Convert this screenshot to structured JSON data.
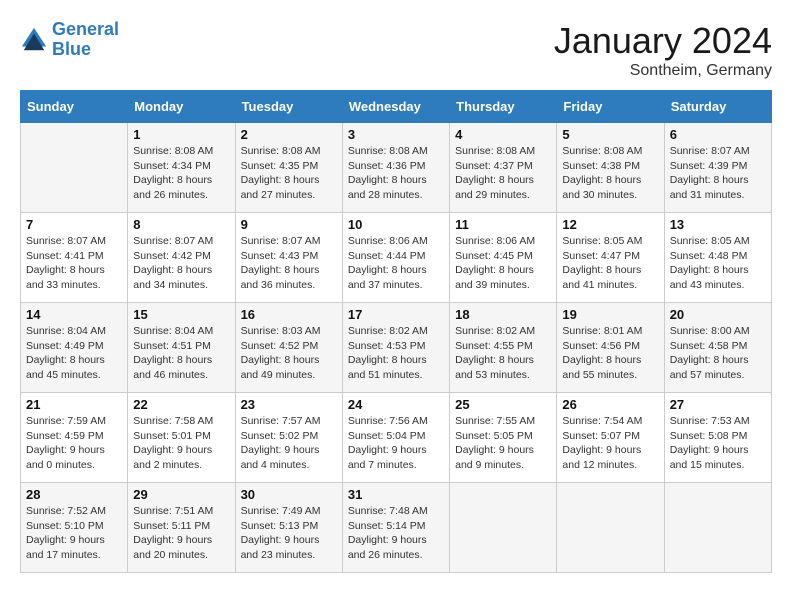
{
  "header": {
    "logo_line1": "General",
    "logo_line2": "Blue",
    "month": "January 2024",
    "location": "Sontheim, Germany"
  },
  "days_of_week": [
    "Sunday",
    "Monday",
    "Tuesday",
    "Wednesday",
    "Thursday",
    "Friday",
    "Saturday"
  ],
  "weeks": [
    [
      {
        "day": "",
        "sunrise": "",
        "sunset": "",
        "daylight": ""
      },
      {
        "day": "1",
        "sunrise": "Sunrise: 8:08 AM",
        "sunset": "Sunset: 4:34 PM",
        "daylight": "Daylight: 8 hours and 26 minutes."
      },
      {
        "day": "2",
        "sunrise": "Sunrise: 8:08 AM",
        "sunset": "Sunset: 4:35 PM",
        "daylight": "Daylight: 8 hours and 27 minutes."
      },
      {
        "day": "3",
        "sunrise": "Sunrise: 8:08 AM",
        "sunset": "Sunset: 4:36 PM",
        "daylight": "Daylight: 8 hours and 28 minutes."
      },
      {
        "day": "4",
        "sunrise": "Sunrise: 8:08 AM",
        "sunset": "Sunset: 4:37 PM",
        "daylight": "Daylight: 8 hours and 29 minutes."
      },
      {
        "day": "5",
        "sunrise": "Sunrise: 8:08 AM",
        "sunset": "Sunset: 4:38 PM",
        "daylight": "Daylight: 8 hours and 30 minutes."
      },
      {
        "day": "6",
        "sunrise": "Sunrise: 8:07 AM",
        "sunset": "Sunset: 4:39 PM",
        "daylight": "Daylight: 8 hours and 31 minutes."
      }
    ],
    [
      {
        "day": "7",
        "sunrise": "Sunrise: 8:07 AM",
        "sunset": "Sunset: 4:41 PM",
        "daylight": "Daylight: 8 hours and 33 minutes."
      },
      {
        "day": "8",
        "sunrise": "Sunrise: 8:07 AM",
        "sunset": "Sunset: 4:42 PM",
        "daylight": "Daylight: 8 hours and 34 minutes."
      },
      {
        "day": "9",
        "sunrise": "Sunrise: 8:07 AM",
        "sunset": "Sunset: 4:43 PM",
        "daylight": "Daylight: 8 hours and 36 minutes."
      },
      {
        "day": "10",
        "sunrise": "Sunrise: 8:06 AM",
        "sunset": "Sunset: 4:44 PM",
        "daylight": "Daylight: 8 hours and 37 minutes."
      },
      {
        "day": "11",
        "sunrise": "Sunrise: 8:06 AM",
        "sunset": "Sunset: 4:45 PM",
        "daylight": "Daylight: 8 hours and 39 minutes."
      },
      {
        "day": "12",
        "sunrise": "Sunrise: 8:05 AM",
        "sunset": "Sunset: 4:47 PM",
        "daylight": "Daylight: 8 hours and 41 minutes."
      },
      {
        "day": "13",
        "sunrise": "Sunrise: 8:05 AM",
        "sunset": "Sunset: 4:48 PM",
        "daylight": "Daylight: 8 hours and 43 minutes."
      }
    ],
    [
      {
        "day": "14",
        "sunrise": "Sunrise: 8:04 AM",
        "sunset": "Sunset: 4:49 PM",
        "daylight": "Daylight: 8 hours and 45 minutes."
      },
      {
        "day": "15",
        "sunrise": "Sunrise: 8:04 AM",
        "sunset": "Sunset: 4:51 PM",
        "daylight": "Daylight: 8 hours and 46 minutes."
      },
      {
        "day": "16",
        "sunrise": "Sunrise: 8:03 AM",
        "sunset": "Sunset: 4:52 PM",
        "daylight": "Daylight: 8 hours and 49 minutes."
      },
      {
        "day": "17",
        "sunrise": "Sunrise: 8:02 AM",
        "sunset": "Sunset: 4:53 PM",
        "daylight": "Daylight: 8 hours and 51 minutes."
      },
      {
        "day": "18",
        "sunrise": "Sunrise: 8:02 AM",
        "sunset": "Sunset: 4:55 PM",
        "daylight": "Daylight: 8 hours and 53 minutes."
      },
      {
        "day": "19",
        "sunrise": "Sunrise: 8:01 AM",
        "sunset": "Sunset: 4:56 PM",
        "daylight": "Daylight: 8 hours and 55 minutes."
      },
      {
        "day": "20",
        "sunrise": "Sunrise: 8:00 AM",
        "sunset": "Sunset: 4:58 PM",
        "daylight": "Daylight: 8 hours and 57 minutes."
      }
    ],
    [
      {
        "day": "21",
        "sunrise": "Sunrise: 7:59 AM",
        "sunset": "Sunset: 4:59 PM",
        "daylight": "Daylight: 9 hours and 0 minutes."
      },
      {
        "day": "22",
        "sunrise": "Sunrise: 7:58 AM",
        "sunset": "Sunset: 5:01 PM",
        "daylight": "Daylight: 9 hours and 2 minutes."
      },
      {
        "day": "23",
        "sunrise": "Sunrise: 7:57 AM",
        "sunset": "Sunset: 5:02 PM",
        "daylight": "Daylight: 9 hours and 4 minutes."
      },
      {
        "day": "24",
        "sunrise": "Sunrise: 7:56 AM",
        "sunset": "Sunset: 5:04 PM",
        "daylight": "Daylight: 9 hours and 7 minutes."
      },
      {
        "day": "25",
        "sunrise": "Sunrise: 7:55 AM",
        "sunset": "Sunset: 5:05 PM",
        "daylight": "Daylight: 9 hours and 9 minutes."
      },
      {
        "day": "26",
        "sunrise": "Sunrise: 7:54 AM",
        "sunset": "Sunset: 5:07 PM",
        "daylight": "Daylight: 9 hours and 12 minutes."
      },
      {
        "day": "27",
        "sunrise": "Sunrise: 7:53 AM",
        "sunset": "Sunset: 5:08 PM",
        "daylight": "Daylight: 9 hours and 15 minutes."
      }
    ],
    [
      {
        "day": "28",
        "sunrise": "Sunrise: 7:52 AM",
        "sunset": "Sunset: 5:10 PM",
        "daylight": "Daylight: 9 hours and 17 minutes."
      },
      {
        "day": "29",
        "sunrise": "Sunrise: 7:51 AM",
        "sunset": "Sunset: 5:11 PM",
        "daylight": "Daylight: 9 hours and 20 minutes."
      },
      {
        "day": "30",
        "sunrise": "Sunrise: 7:49 AM",
        "sunset": "Sunset: 5:13 PM",
        "daylight": "Daylight: 9 hours and 23 minutes."
      },
      {
        "day": "31",
        "sunrise": "Sunrise: 7:48 AM",
        "sunset": "Sunset: 5:14 PM",
        "daylight": "Daylight: 9 hours and 26 minutes."
      },
      {
        "day": "",
        "sunrise": "",
        "sunset": "",
        "daylight": ""
      },
      {
        "day": "",
        "sunrise": "",
        "sunset": "",
        "daylight": ""
      },
      {
        "day": "",
        "sunrise": "",
        "sunset": "",
        "daylight": ""
      }
    ]
  ]
}
